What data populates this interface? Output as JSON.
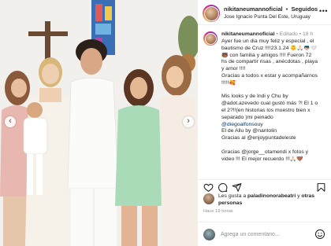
{
  "header": {
    "username": "nikitaneumannoficial",
    "separator": "•",
    "follow_status": "Seguidos",
    "location": "Jose Ignacio Punta Del Este, Uruguay",
    "more_icon": "more-horizontal-icon"
  },
  "photo": {
    "prev_icon": "chevron-left-icon",
    "next_icon": "chevron-right-icon",
    "prev_glyph": "‹",
    "next_glyph": "›"
  },
  "caption": {
    "username": "nikitaneumannoficial",
    "meta": "• Editado • 18 h",
    "lines": [
      "Ayer fue un dia muy feliz y especial , el",
      "bautismo de Cruz !!!!23.1.24 👶🙏🏻👼🏻🤍",
      "🐻 con familia y amigos !!!! Fueron 72",
      "hs de compartir risas , anécdotas , playa",
      "y amor !!!!",
      "Gracias a todos x estar y acompañarnos",
      "!!!!!🥰"
    ],
    "lines2": [
      "Mis looks y de Indi y Chu by",
      "@adot.azevedo cual gustó más ?! El 1 o",
      "el 2?!!(en historias los muestro bien x",
      "separado )mi peinado",
      "@diegoalfonsouy",
      "El de Allu by @nantolin",
      "Gracias al @enjoypuntadeleste"
    ],
    "lines3": [
      "Gracias @jorge__otamendi x fotos y",
      "video !!! El mejor recuerdo !!!🙏🏻🤎"
    ]
  },
  "actions": {
    "like_icon": "heart-icon",
    "comment_icon": "comment-icon",
    "share_icon": "share-icon",
    "save_icon": "bookmark-icon"
  },
  "likes": {
    "prefix": "Les gusta a ",
    "user": "paladinonorabeatri",
    "middle": " y ",
    "others": "otras personas"
  },
  "time_ago": "Hace 19 horas",
  "comment": {
    "placeholder": "Agrega un comentario...",
    "emoji_icon": "emoji-smile-icon"
  },
  "colors": {
    "text": "#262626",
    "secondary": "#8e8e8e",
    "mention": "#00376b",
    "divider": "#efefef",
    "story_ring": "#ee2a7b"
  }
}
